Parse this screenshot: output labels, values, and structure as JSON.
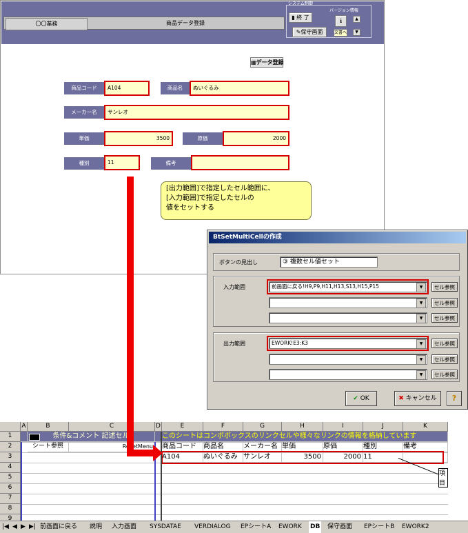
{
  "form": {
    "tab_main": "〇〇業務",
    "tab_title": "商品データ登録",
    "system_label": "システム制御",
    "version_label": "バージョン情報",
    "exit_button": "終 了",
    "maintenance_button": "保守画面",
    "doc_button": "文書へ",
    "register_button": "データ登録",
    "fields": {
      "product_code": {
        "label": "商品コード",
        "value": "A104"
      },
      "product_name": {
        "label": "商品名",
        "value": "ぬいぐるみ"
      },
      "maker_name": {
        "label": "メーカー名",
        "value": "サンレオ"
      },
      "unit_price": {
        "label": "単価",
        "value": "3500"
      },
      "cost": {
        "label": "原価",
        "value": "2000"
      },
      "category": {
        "label": "種別",
        "value": "11"
      },
      "remarks": {
        "label": "備考",
        "value": ""
      }
    }
  },
  "callout": {
    "line1": "[出力範囲]で指定したセル範囲に、",
    "line2": "[入力範囲]で指定したセルの",
    "line3": "値をセットする"
  },
  "dialog": {
    "title": "BtSetMultiCellの作成",
    "caption_label": "ボタンの見出し",
    "caption_value": "③ 複数セル値セット",
    "input_label": "入力範囲",
    "input_range_1": "前画面に戻る!H9,P9,H11,H13,S13,H15,P15",
    "input_range_2": "",
    "input_range_3": "",
    "output_label": "出力範囲",
    "output_range_1": "EWORK!E3:K3",
    "output_range_2": "",
    "output_range_3": "",
    "ref_button": "セル参照",
    "ok_button": "OK",
    "cancel_button": "キャンセル",
    "help_button": "?"
  },
  "sheet": {
    "columns": [
      "A",
      "B",
      "C",
      "D",
      "E",
      "F",
      "G",
      "H",
      "I",
      "J",
      "K"
    ],
    "rows": [
      "1",
      "2",
      "3",
      "4",
      "5",
      "6",
      "7",
      "8",
      "9"
    ],
    "b1_title": "条件&コメント 記述セル",
    "row1_banner": "このシートはコンボボックスのリンクセルや様々なリンクの情報を格納しています",
    "b2": "シート参照",
    "c2": "ResetMenu",
    "headers": [
      "商品コード",
      "商品名",
      "メーカー名",
      "単価",
      "原価",
      "種別",
      "備考"
    ],
    "values": [
      "A104",
      "ぬいぐるみ",
      "サンレオ",
      "3500",
      "2000",
      "11",
      ""
    ],
    "note": "項目"
  },
  "sheet_tabs": [
    "前画面に戻る",
    "説明",
    "入力画面",
    "SYSDATAE",
    "VERDIALOG",
    "EPシートA",
    "EWORK",
    "DB",
    "保守画面",
    "EPシートB",
    "EWORK2"
  ],
  "colors": {
    "accent": "#6e6e9e",
    "highlight": "#d40000",
    "field_bg": "#ffffcc"
  }
}
